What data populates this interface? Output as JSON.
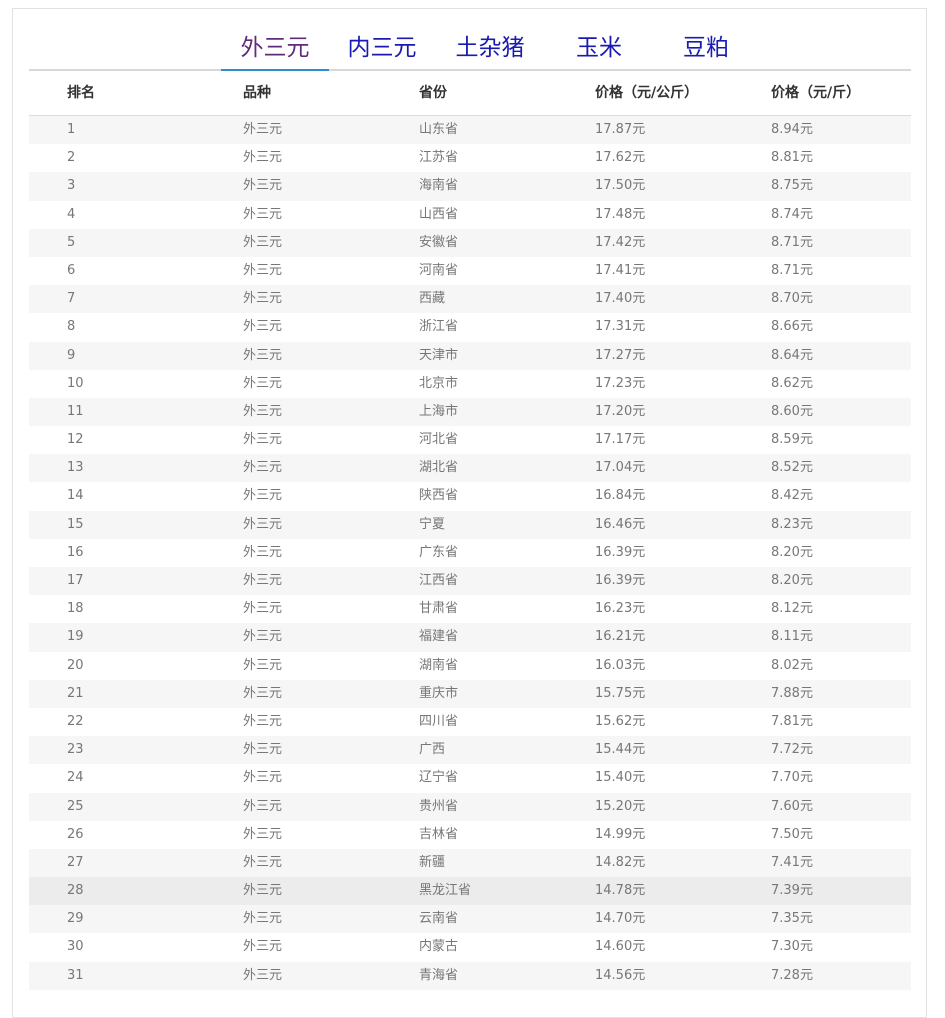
{
  "tabs": [
    {
      "label": "外三元",
      "active": true
    },
    {
      "label": "内三元",
      "active": false
    },
    {
      "label": "土杂猪",
      "active": false
    },
    {
      "label": "玉米",
      "active": false
    },
    {
      "label": "豆粕",
      "active": false
    }
  ],
  "table": {
    "headers": [
      "排名",
      "品种",
      "省份",
      "价格（元/公斤）",
      "价格（元/斤）"
    ],
    "highlight_row_rank": "28",
    "rows": [
      [
        "1",
        "外三元",
        "山东省",
        "17.87元",
        "8.94元"
      ],
      [
        "2",
        "外三元",
        "江苏省",
        "17.62元",
        "8.81元"
      ],
      [
        "3",
        "外三元",
        "海南省",
        "17.50元",
        "8.75元"
      ],
      [
        "4",
        "外三元",
        "山西省",
        "17.48元",
        "8.74元"
      ],
      [
        "5",
        "外三元",
        "安徽省",
        "17.42元",
        "8.71元"
      ],
      [
        "6",
        "外三元",
        "河南省",
        "17.41元",
        "8.71元"
      ],
      [
        "7",
        "外三元",
        "西藏",
        "17.40元",
        "8.70元"
      ],
      [
        "8",
        "外三元",
        "浙江省",
        "17.31元",
        "8.66元"
      ],
      [
        "9",
        "外三元",
        "天津市",
        "17.27元",
        "8.64元"
      ],
      [
        "10",
        "外三元",
        "北京市",
        "17.23元",
        "8.62元"
      ],
      [
        "11",
        "外三元",
        "上海市",
        "17.20元",
        "8.60元"
      ],
      [
        "12",
        "外三元",
        "河北省",
        "17.17元",
        "8.59元"
      ],
      [
        "13",
        "外三元",
        "湖北省",
        "17.04元",
        "8.52元"
      ],
      [
        "14",
        "外三元",
        "陕西省",
        "16.84元",
        "8.42元"
      ],
      [
        "15",
        "外三元",
        "宁夏",
        "16.46元",
        "8.23元"
      ],
      [
        "16",
        "外三元",
        "广东省",
        "16.39元",
        "8.20元"
      ],
      [
        "17",
        "外三元",
        "江西省",
        "16.39元",
        "8.20元"
      ],
      [
        "18",
        "外三元",
        "甘肃省",
        "16.23元",
        "8.12元"
      ],
      [
        "19",
        "外三元",
        "福建省",
        "16.21元",
        "8.11元"
      ],
      [
        "20",
        "外三元",
        "湖南省",
        "16.03元",
        "8.02元"
      ],
      [
        "21",
        "外三元",
        "重庆市",
        "15.75元",
        "7.88元"
      ],
      [
        "22",
        "外三元",
        "四川省",
        "15.62元",
        "7.81元"
      ],
      [
        "23",
        "外三元",
        "广西",
        "15.44元",
        "7.72元"
      ],
      [
        "24",
        "外三元",
        "辽宁省",
        "15.40元",
        "7.70元"
      ],
      [
        "25",
        "外三元",
        "贵州省",
        "15.20元",
        "7.60元"
      ],
      [
        "26",
        "外三元",
        "吉林省",
        "14.99元",
        "7.50元"
      ],
      [
        "27",
        "外三元",
        "新疆",
        "14.82元",
        "7.41元"
      ],
      [
        "28",
        "外三元",
        "黑龙江省",
        "14.78元",
        "7.39元"
      ],
      [
        "29",
        "外三元",
        "云南省",
        "14.70元",
        "7.35元"
      ],
      [
        "30",
        "外三元",
        "内蒙古",
        "14.60元",
        "7.30元"
      ],
      [
        "31",
        "外三元",
        "青海省",
        "14.56元",
        "7.28元"
      ]
    ]
  }
}
